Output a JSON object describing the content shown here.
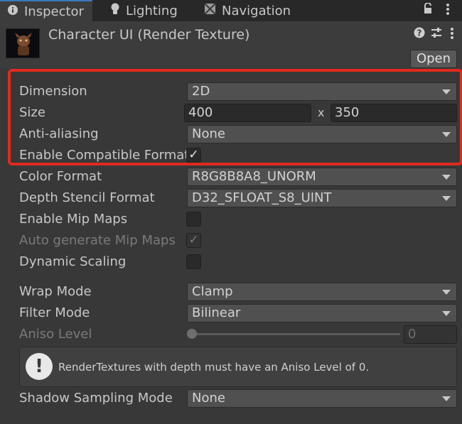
{
  "tabs": [
    {
      "label": "Inspector",
      "icon": "info-icon"
    },
    {
      "label": "Lighting",
      "icon": "lightbulb-icon"
    },
    {
      "label": "Navigation",
      "icon": "navigation-icon"
    }
  ],
  "header": {
    "title": "Character UI (Render Texture)",
    "open_label": "Open"
  },
  "fields": {
    "dimension": {
      "label": "Dimension",
      "value": "2D"
    },
    "size": {
      "label": "Size",
      "width": "400",
      "separator": "x",
      "height": "350"
    },
    "anti_aliasing": {
      "label": "Anti-aliasing",
      "value": "None"
    },
    "enable_compatible_format": {
      "label": "Enable Compatible Format",
      "checked": true,
      "mark": "✓"
    },
    "color_format": {
      "label": "Color Format",
      "value": "R8G8B8A8_UNORM"
    },
    "depth_stencil_format": {
      "label": "Depth Stencil Format",
      "value": "D32_SFLOAT_S8_UINT"
    },
    "enable_mip_maps": {
      "label": "Enable Mip Maps",
      "checked": false,
      "mark": ""
    },
    "auto_generate_mip_maps": {
      "label": "Auto generate Mip Maps",
      "checked": true,
      "mark": "✓"
    },
    "dynamic_scaling": {
      "label": "Dynamic Scaling",
      "checked": false,
      "mark": ""
    },
    "wrap_mode": {
      "label": "Wrap Mode",
      "value": "Clamp"
    },
    "filter_mode": {
      "label": "Filter Mode",
      "value": "Bilinear"
    },
    "aniso_level": {
      "label": "Aniso Level",
      "value": "0",
      "slider_level": 0
    },
    "shadow_sampling_mode": {
      "label": "Shadow Sampling Mode",
      "value": "None"
    }
  },
  "help": {
    "icon_glyph": "!",
    "text": "RenderTextures with depth must have an Aniso Level of 0."
  },
  "colors": {
    "highlight": "#e12a1e",
    "active_tab_accent": "#3a79bb"
  }
}
